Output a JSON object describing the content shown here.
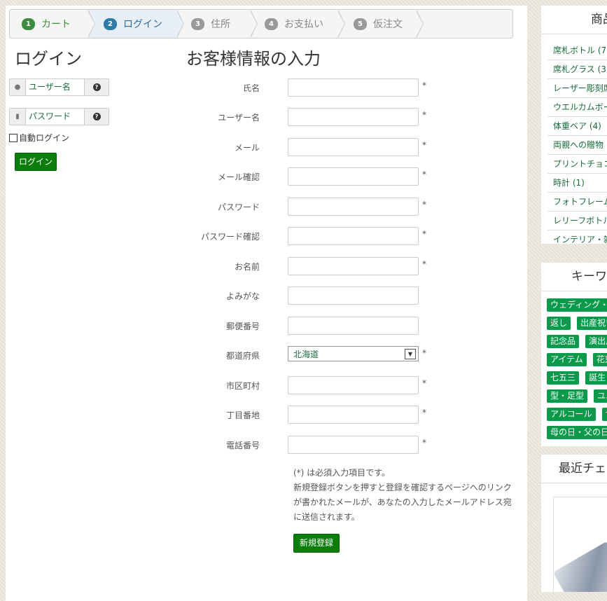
{
  "steps": [
    {
      "num": "1",
      "label": "カート"
    },
    {
      "num": "2",
      "label": "ログイン"
    },
    {
      "num": "3",
      "label": "住所"
    },
    {
      "num": "4",
      "label": "お支払い"
    },
    {
      "num": "5",
      "label": "仮注文"
    }
  ],
  "login": {
    "title": "ログイン",
    "username_placeholder": "ユーザー名",
    "password_placeholder": "パスワード",
    "help": "?",
    "auto_login": "自動ログイン",
    "button": "ログイン"
  },
  "register": {
    "title": "お客様情報の入力",
    "fields": [
      {
        "label": "氏名",
        "req": "*"
      },
      {
        "label": "ユーザー名",
        "req": "*"
      },
      {
        "label": "メール",
        "req": "*"
      },
      {
        "label": "メール確認",
        "req": "*"
      },
      {
        "label": "パスワード",
        "req": "*"
      },
      {
        "label": "パスワード確認",
        "req": "*"
      },
      {
        "label": "お名前",
        "req": "*"
      },
      {
        "label": "よみがな",
        "req": ""
      },
      {
        "label": "郵便番号",
        "req": ""
      },
      {
        "label": "都道府県",
        "req": "*",
        "select": "北海道"
      },
      {
        "label": "市区町村",
        "req": "*"
      },
      {
        "label": "丁目番地",
        "req": "*"
      },
      {
        "label": "電話番号",
        "req": "*"
      }
    ],
    "note1": "(*) は必須入力項目です。",
    "note2": "新規登録ボタンを押すと登録を確認するページへのリンクが書かれたメールが、あなたの入力したメールアドレス宛に送信されます。",
    "submit": "新規登録"
  },
  "sidebar": {
    "categories_title": "商品",
    "categories": [
      "席札ボトル (7",
      "席札グラス (3",
      "レーザー彫刻席",
      "ウエルカムボー",
      "体重ベア (4)",
      "両親への贈物 (",
      "プリントチョコ",
      "時計 (1)",
      "フォトフレーム",
      "レリーフボトル",
      "インテリア・雑"
    ],
    "keywords_title": "キーワ",
    "keywords": [
      "ウェディング・",
      "返し",
      "出産祝い",
      "記念品",
      "演出用",
      "アイテム",
      "花束",
      "七五三",
      "誕生",
      "型・足型",
      "ユニ",
      "アルコール",
      "サ",
      "母の日・父の日"
    ],
    "recent_title": "最近チェ"
  }
}
